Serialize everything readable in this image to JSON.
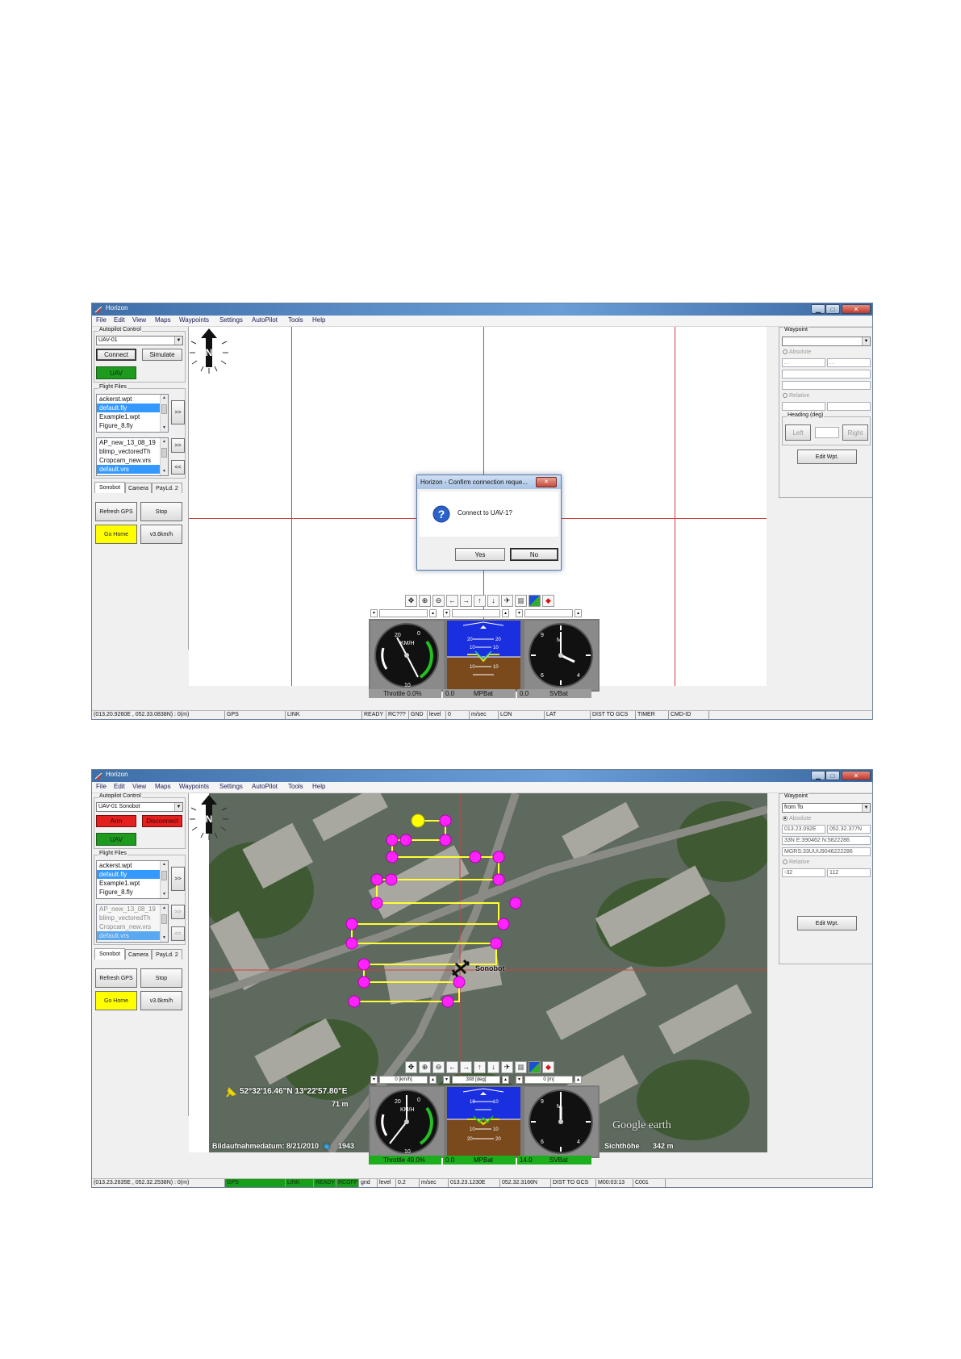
{
  "app": {
    "title": "Horizon",
    "menu": [
      "File",
      "Edit",
      "View",
      "Maps",
      "Waypoints",
      "Settings",
      "AutoPilot",
      "Tools",
      "Help"
    ],
    "window_buttons": {
      "minimize": "▁",
      "maximize": "□",
      "close": "✕"
    },
    "compass_label": "N"
  },
  "screens": [
    {
      "autopilot": {
        "group_label": "Autopilot Control",
        "uav_select": "UAV-01",
        "btn1": "Connect",
        "btn2": "Simulate",
        "uav_badge": "UAV"
      },
      "flight_files": {
        "group_label": "Flight Files",
        "list1": [
          "ackerst.wpt",
          "default.fly",
          "Example1.wpt",
          "Figure_8.fly"
        ],
        "list1_selected": 1,
        "list2": [
          "AP_new_13_08_19",
          "blimp_vectoredTh",
          "Cropcam_new.vrs",
          "default.vrs"
        ],
        "list2_selected": 3,
        "btn_forward1": ">>",
        "btn_forward2": ">>",
        "btn_back": "<<"
      },
      "tabs": [
        "Sonobot",
        "Camera",
        "PayLd. 2"
      ],
      "actions": {
        "refresh": "Refresh GPS",
        "stop": "Stop",
        "go_home": "Go Home",
        "speed": "v3.6km/h"
      },
      "waypoint": {
        "group_label": "Waypoint",
        "select": "",
        "absolute_label": "Absolute",
        "abs_fields": [
          ". .",
          ". ."
        ],
        "abs_wide": [
          "",
          ""
        ],
        "relative_label": "Relative",
        "rel_fields": [
          "",
          ""
        ],
        "heading_label": "Heading (deg)",
        "left": "Left",
        "heading_value": "",
        "right": "Right",
        "edit": "Edit Wpt."
      },
      "dialog": {
        "title": "Horizon - Confirm connection reque...",
        "message": "Connect to UAV-1?",
        "yes": "Yes",
        "no": "No",
        "close": "✕"
      },
      "instruments": {
        "fields": [
          "",
          "",
          ""
        ],
        "speed_unit": "KM/H",
        "speed_ticks": [
          "20",
          "0",
          "10"
        ],
        "attitude_ticks": [
          "20",
          "20",
          "10",
          "10",
          "10",
          "10"
        ],
        "clock_ticks": [
          "9",
          "M",
          "6",
          "4"
        ],
        "throttle": "Throttle 0.0%",
        "mpbat_value": "0.0",
        "mpbat": "MPBat",
        "svbat_value": "0.0",
        "svbat": "SVBat"
      },
      "status": [
        "(013.20.9260E , 052.33.0838N) : 0(m)",
        "GPS",
        "LINK",
        "READY",
        "RC???",
        "GND",
        "level",
        "0",
        "m/sec",
        "LON",
        "LAT",
        "DIST TO GCS",
        "TIMER",
        "CMD-ID"
      ]
    },
    {
      "autopilot": {
        "group_label": "Autopilot Control",
        "uav_select": "UAV-01 Sonobot",
        "btn1": "Arm",
        "btn2": "Disconnect",
        "uav_badge": "UAV"
      },
      "flight_files": {
        "group_label": "Flight Files",
        "list1": [
          "ackerst.wpt",
          "default.fly",
          "Example1.wpt",
          "Figure_8.fly"
        ],
        "list1_selected": 1,
        "list2": [
          "AP_new_13_08_19",
          "blimp_vectoredTh",
          "Cropcam_new.vrs",
          "default.vrs"
        ],
        "list2_selected": 3,
        "btn_forward1": ">>",
        "btn_forward2": ">>",
        "btn_back": "<<"
      },
      "tabs": [
        "Sonobot",
        "Camera",
        "PayLd. 2"
      ],
      "actions": {
        "refresh": "Refresh GPS",
        "stop": "Stop",
        "go_home": "Go Home",
        "speed": "v3.6km/h"
      },
      "waypoint": {
        "group_label": "Waypoint",
        "select": "from To",
        "absolute_label": "Absolute",
        "abs_fields": [
          "013.23.092E",
          "052.32.377N"
        ],
        "abs_wide": [
          "33N E:390462 N:5822286",
          "MGRS:33UUU9046222286"
        ],
        "relative_label": "Relative",
        "rel_fields": [
          "-32",
          "112"
        ],
        "edit": "Edit Wpt."
      },
      "map_overlay": {
        "vehicle_label": "Sonobot",
        "coords": "52°32'16.46\"N 13°22'57.80\"E",
        "elevation": "71 m",
        "imagery_date": "Bildaufnahmedatum: 8/21/2010",
        "year": "1943",
        "brand": "Google earth",
        "eye_alt_label": "Sichthöhe",
        "eye_alt": "342 m"
      },
      "instruments": {
        "fields": [
          "0 [km/h]",
          "308 [deg]",
          "0 [m]"
        ],
        "speed_unit": "KM/H",
        "speed_ticks": [
          "20",
          "0",
          "10"
        ],
        "attitude_ticks": [
          "10",
          "10",
          "10",
          "10",
          "20",
          "20"
        ],
        "clock_ticks": [
          "9",
          "M",
          "6",
          "4"
        ],
        "throttle": "Throttle 49.0%",
        "mpbat_value": "0.0",
        "mpbat": "MPBat",
        "svbat_value": "14.0",
        "svbat": "SVBat"
      },
      "status": [
        "(013.23.2635E , 052.32.2538N) : 0(m)",
        "GPS",
        "LINK",
        "READY",
        "RCOFF",
        "gnd",
        "level",
        "0.2",
        "m/sec",
        "013.23.1230E",
        "052.32.3166N",
        "DIST TO GCS",
        "M00:03:13",
        "C001"
      ]
    }
  ],
  "colors": {
    "title_bar": "#4a7fbf",
    "uav_green": "#1e9a1e",
    "arm_red": "#e32020",
    "go_home_yellow": "#ffff00",
    "waypoint_magenta": "#ff22ff",
    "route_yellow": "#ffff33",
    "grid_red": "#d04040",
    "sky_blue": "#1a2fe0",
    "ground_brown": "#7a4a1c"
  }
}
